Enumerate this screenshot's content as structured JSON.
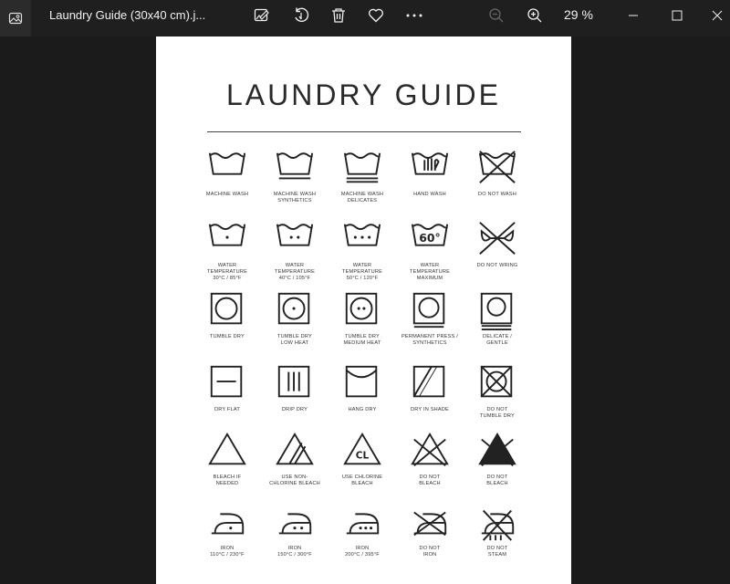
{
  "window": {
    "file_title": "Laundry Guide (30x40 cm).j...",
    "zoom": "29 %",
    "toolbar": [
      "edit-image-icon",
      "rotate-icon",
      "delete-icon",
      "favorite-icon",
      "more-icon"
    ],
    "window_controls": [
      "minimize-icon",
      "maximize-icon",
      "close-icon"
    ]
  },
  "poster": {
    "title": "LAUNDRY GUIDE",
    "rows": [
      [
        {
          "icon": "machine-wash-icon",
          "label": "MACHINE WASH"
        },
        {
          "icon": "machine-wash-synthetics-icon",
          "label": "MACHINE WASH\nSYNTHETICS"
        },
        {
          "icon": "machine-wash-delicates-icon",
          "label": "MACHINE WASH\nDELICATES"
        },
        {
          "icon": "hand-wash-icon",
          "label": "HAND WASH"
        },
        {
          "icon": "do-not-wash-icon",
          "label": "DO NOT WASH"
        }
      ],
      [
        {
          "icon": "water-30-icon",
          "label": "WATER\nTEMPERATURE\n30°C / 85°F"
        },
        {
          "icon": "water-40-icon",
          "label": "WATER\nTEMPERATURE\n40°C / 105°F"
        },
        {
          "icon": "water-50-icon",
          "label": "WATER\nTEMPERATURE\n50°C / 120°F"
        },
        {
          "icon": "water-60-icon",
          "label": "WATER\nTEMPERATURE\nMAXIMUM",
          "text": "60°"
        },
        {
          "icon": "do-not-wring-icon",
          "label": "DO NOT WRING"
        }
      ],
      [
        {
          "icon": "tumble-dry-icon",
          "label": "TUMBLE DRY"
        },
        {
          "icon": "tumble-dry-low-icon",
          "label": "TUMBLE DRY\nLOW HEAT"
        },
        {
          "icon": "tumble-dry-medium-icon",
          "label": "TUMBLE DRY\nMEDIUM HEAT"
        },
        {
          "icon": "permanent-press-icon",
          "label": "PERMANENT PRESS /\nSYNTHETICS"
        },
        {
          "icon": "delicate-gentle-icon",
          "label": "DELICATE /\nGENTLE"
        }
      ],
      [
        {
          "icon": "dry-flat-icon",
          "label": "DRY FLAT"
        },
        {
          "icon": "drip-dry-icon",
          "label": "DRIP DRY"
        },
        {
          "icon": "hang-dry-icon",
          "label": "HANG DRY"
        },
        {
          "icon": "dry-in-shade-icon",
          "label": "DRY IN SHADE"
        },
        {
          "icon": "do-not-tumble-dry-icon",
          "label": "DO NOT\nTUMBLE DRY"
        }
      ],
      [
        {
          "icon": "bleach-if-needed-icon",
          "label": "BLEACH IF\nNEEDED"
        },
        {
          "icon": "non-chlorine-bleach-icon",
          "label": "USE NON-\nCHLORINE BLEACH"
        },
        {
          "icon": "chlorine-bleach-icon",
          "label": "USE CHLORINE\nBLEACH",
          "text": "CL"
        },
        {
          "icon": "do-not-bleach-outline-icon",
          "label": "DO NOT\nBLEACH"
        },
        {
          "icon": "do-not-bleach-solid-icon",
          "label": "DO NOT\nBLEACH"
        }
      ],
      [
        {
          "icon": "iron-low-icon",
          "label": "IRON\n110°C / 230°F"
        },
        {
          "icon": "iron-medium-icon",
          "label": "IRON\n150°C / 300°F"
        },
        {
          "icon": "iron-high-icon",
          "label": "IRON\n200°C / 395°F"
        },
        {
          "icon": "do-not-iron-icon",
          "label": "DO NOT\nIRON"
        },
        {
          "icon": "do-not-steam-icon",
          "label": "DO NOT\nSTEAM"
        }
      ]
    ]
  }
}
